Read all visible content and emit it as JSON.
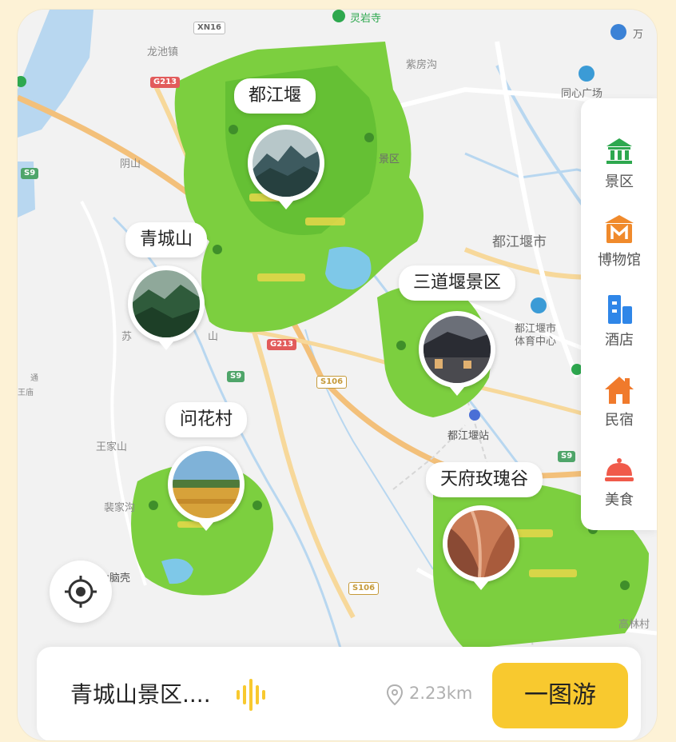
{
  "map": {
    "labels": {
      "longchizhen": "龙池镇",
      "xn16": "XN16",
      "lingyansi": "灵岩寺",
      "zifangou": "紫房沟",
      "tongxinguangchang": "同心广场",
      "wan": "万",
      "g213_top": "G213",
      "yinshan": "阴山",
      "s9_left": "S9",
      "jingqu_fragment": "景区",
      "dujiangyan_city": "都江堰市",
      "sports_center_line1": "都江堰市",
      "sports_center_line2": "体育中心",
      "su_fragment": "苏",
      "shan_fragment": "山",
      "g213_mid": "G213",
      "s9_mid": "S9",
      "s106_mid": "S106",
      "wangjiashan": "王家山",
      "peijiagou": "裴家沟",
      "dunaoke": "大脑壳",
      "dujiangyan_station": "都江堰站",
      "s106_bottom": "S106",
      "gaolincun": "高林村",
      "s9_right": "S9",
      "wangmiao": "王庙",
      "tong": "通"
    }
  },
  "pois": [
    {
      "name": "都江堰",
      "photo": "mountain-mist"
    },
    {
      "name": "青城山",
      "photo": "green-mountains"
    },
    {
      "name": "三道堰景区",
      "photo": "old-town-roofs"
    },
    {
      "name": "问花村",
      "photo": "flower-field"
    },
    {
      "name": "天府玫瑰谷",
      "photo": "rock-canyon"
    }
  ],
  "categories": [
    {
      "label": "景区",
      "icon": "scenic-spot-icon",
      "color": "#2ea84f"
    },
    {
      "label": "博物馆",
      "icon": "museum-icon",
      "color": "#f08a2c"
    },
    {
      "label": "酒店",
      "icon": "hotel-icon",
      "color": "#2f86e8"
    },
    {
      "label": "民宿",
      "icon": "homestay-icon",
      "color": "#f07a2c"
    },
    {
      "label": "美食",
      "icon": "food-icon",
      "color": "#f05a4a"
    }
  ],
  "bottom_card": {
    "place_name": "青城山景区....",
    "distance": "2.23km",
    "tour_button": "一图游"
  },
  "colors": {
    "accent_yellow": "#f8c92f",
    "map_green": "#7ccf3f"
  }
}
